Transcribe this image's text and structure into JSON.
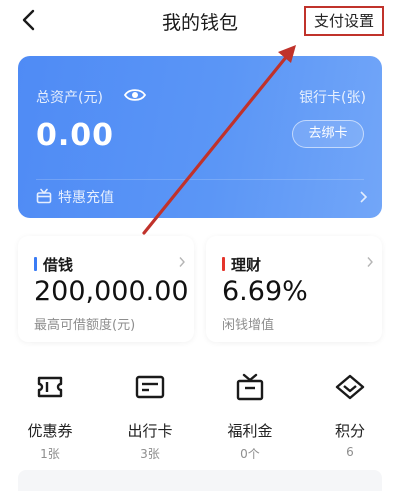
{
  "header": {
    "title": "我的钱包",
    "pay_settings": "支付设置"
  },
  "wallet_card": {
    "asset_label": "总资产(元)",
    "asset_value": "0.00",
    "bank_label": "银行卡(张)",
    "unbind_button": "去绑卡",
    "promo_text": "特惠充值"
  },
  "tiles": {
    "borrow": {
      "title": "借钱",
      "value": "200,000.00",
      "subtitle": "最高可借额度(元)",
      "accent": "#3b7cf5"
    },
    "invest": {
      "title": "理财",
      "value": "6.69%",
      "subtitle": "闲钱增值",
      "accent": "#e5352c"
    }
  },
  "shortcuts": [
    {
      "label": "优惠券",
      "count": "1张",
      "icon": "ticket-icon"
    },
    {
      "label": "出行卡",
      "count": "3张",
      "icon": "card-icon"
    },
    {
      "label": "福利金",
      "count": "0个",
      "icon": "gift-box-icon"
    },
    {
      "label": "积分",
      "count": "6",
      "icon": "diamond-icon"
    }
  ],
  "colors": {
    "card_blue": "#4f8bf5",
    "annotation_red": "#c0322b"
  }
}
